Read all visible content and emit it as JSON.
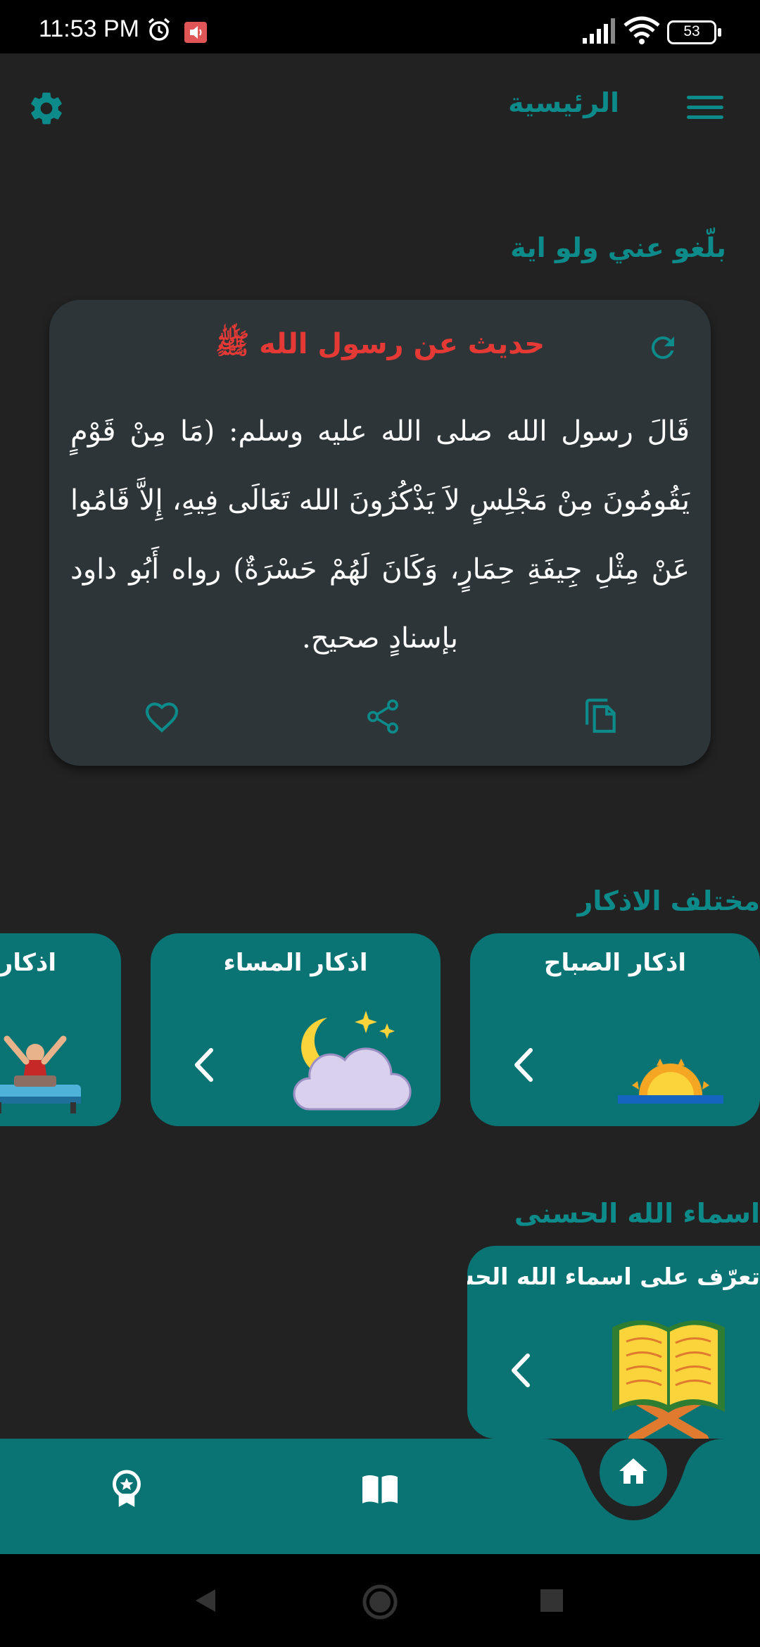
{
  "status_bar": {
    "time": "11:53 PM",
    "battery": "53"
  },
  "header": {
    "title": "الرئيسية"
  },
  "banner_text": "بلّغو عني ولو اية",
  "hadith_card": {
    "title": "حديث عن رسول الله ﷺ",
    "text": "قَالَ رسول الله صلى الله عليه وسلم: (مَا مِنْ قَوْمٍ يَقُومُونَ مِنْ مَجْلِسٍ لاَ يَذْكُرُونَ الله تَعَالَى فِيهِ، إِلاَّ قَامُوا عَنْ مِثْلِ جِيفَةِ حِمَارٍ، وَكَانَ لَهُمْ حَسْرَةٌ) رواه أَبُو داود بإسنادٍ صحيح."
  },
  "sections": {
    "adhkar_label": "مختلف الاذكار",
    "names_label": "اسماء الله الحسنى"
  },
  "adhkar": [
    {
      "title": "اذكار الصباح",
      "icon": "sunrise-icon"
    },
    {
      "title": "اذكار المساء",
      "icon": "moon-cloud-icon"
    },
    {
      "title": "اذكار",
      "icon": "waking-person-icon"
    }
  ],
  "names_card": {
    "title": "تعرّف على اسماء الله الحسنى",
    "icon": "quran-book-icon"
  },
  "colors": {
    "accent": "#0d8a8a",
    "card": "#0a7474",
    "hadith_title": "#e53935",
    "background": "#222222"
  },
  "bottom_nav": [
    {
      "name": "badge-star-icon"
    },
    {
      "name": "open-book-icon"
    },
    {
      "name": "home-icon"
    }
  ]
}
